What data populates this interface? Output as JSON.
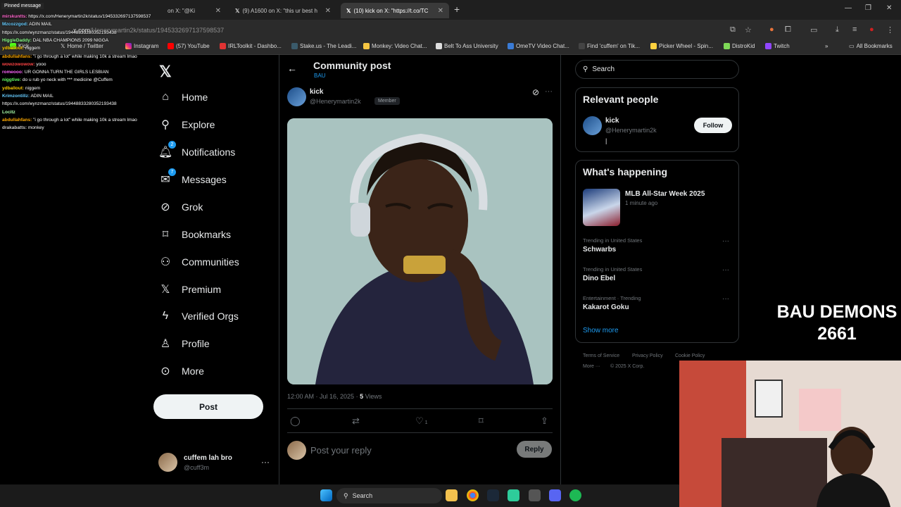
{
  "browser": {
    "tabs": [
      {
        "label": "on X: \"@Ki"
      },
      {
        "label": "(9) A1600 on X: \"this ur best h"
      },
      {
        "label": "(10) kick on X: \"https://t.co/TC"
      }
    ],
    "url_host": "x.com",
    "url_path": "/Henerymartin2k/status/1945332697137598537",
    "bookmarks": [
      {
        "label": "(57) YouTube",
        "color": "#ff0000"
      },
      {
        "label": "IRLToolkit - Dashbo...",
        "color": "#e03333"
      },
      {
        "label": "Stake.us - The Leadi...",
        "color": "#1a2c38"
      },
      {
        "label": "Monkey: Video Chat...",
        "color": "#f5c542"
      },
      {
        "label": "Belt To Ass University",
        "color": "#dddddd"
      },
      {
        "label": "OmeTV Video Chat...",
        "color": "#3a7bd5"
      },
      {
        "label": "Find 'cuffem' on Tik...",
        "color": "#111111"
      },
      {
        "label": "Picker Wheel - Spin...",
        "color": "#ffd23f"
      },
      {
        "label": "DistroKid",
        "color": "#7ed957"
      },
      {
        "label": "Twitch",
        "color": "#9146ff"
      }
    ],
    "all_bookmarks": "All Bookmarks",
    "instagram": "Instagram",
    "home_bm": "Home / Twitter",
    "kick_bm": "Kick"
  },
  "stream_chat": {
    "pinned": "Pinned message",
    "lines": [
      {
        "user": "mirskuntts:",
        "text": "https://x.com/Henerymartin2k/status/1945332697137598537",
        "color": "#ff66cc"
      },
      {
        "user": "Mzcozzgod:",
        "text": "ADIN MAIL",
        "color": "#66ccff"
      },
      {
        "user": "",
        "text": "https://x.com/wynzmanz/status/19448833280352193438",
        "color": "#ffffff"
      },
      {
        "user": "HiggleDaddy:",
        "text": "DAL NBA CHAMPIONS 2099 NIGGA",
        "color": "#88ff88"
      },
      {
        "user": "ydballout:",
        "text": "niggem",
        "color": "#ffcc00"
      },
      {
        "user": "abdullahfans:",
        "text": "\"i go through a lot\" while making 10k a stream lmao",
        "color": "#ffaa00"
      },
      {
        "user": "wowzowowow:",
        "text": "yooo",
        "color": "#ff4444"
      },
      {
        "user": "romeooo:",
        "text": "UR GONNA TURN THE GIRLS LESBIAN",
        "color": "#ff66ff"
      },
      {
        "user": "niggtive:",
        "text": "do u rub yo neck with *** medicine @Cuffem",
        "color": "#66ff66"
      },
      {
        "user": "ydballout:",
        "text": "niggem",
        "color": "#ffcc00"
      },
      {
        "user": "Krimzontillz:",
        "text": "ADIN MAIL",
        "color": "#66ccff"
      },
      {
        "user": "",
        "text": "https://x.com/wynzmanz/status/19448833280352193438",
        "color": "#ffffff"
      },
      {
        "user": "Locitz",
        "text": "",
        "color": "#aaffaa"
      },
      {
        "user": "abdullahfans:",
        "text": "\"i go through a lot\" while making 10k a stream lmao",
        "color": "#ffaa00"
      },
      {
        "user": "drakabatts:",
        "text": "monkey",
        "color": "#cccccc"
      }
    ]
  },
  "sidebar": {
    "items": [
      {
        "label": "Home",
        "icon": "home-icon"
      },
      {
        "label": "Explore",
        "icon": "search-icon"
      },
      {
        "label": "Notifications",
        "icon": "bell-icon",
        "badge": "2"
      },
      {
        "label": "Messages",
        "icon": "envelope-icon",
        "badge": "7"
      },
      {
        "label": "Grok",
        "icon": "grok-icon"
      },
      {
        "label": "Bookmarks",
        "icon": "bookmark-icon"
      },
      {
        "label": "Communities",
        "icon": "people-icon"
      },
      {
        "label": "Premium",
        "icon": "x-premium-icon"
      },
      {
        "label": "Verified Orgs",
        "icon": "lightning-icon"
      },
      {
        "label": "Profile",
        "icon": "person-icon"
      },
      {
        "label": "More",
        "icon": "more-circle-icon"
      }
    ],
    "post_label": "Post",
    "account": {
      "name": "cuffem lah bro",
      "handle": "@cuff3m"
    }
  },
  "main": {
    "title": "Community post",
    "subtitle": "BAU",
    "author": {
      "name": "kick",
      "handle": "@Henerymartin2k",
      "badge": "Member"
    },
    "timestamp": "12:00 AM · Jul 16, 2025 · ",
    "views_count": "5",
    "views_label": " Views",
    "likes": "1",
    "reply_placeholder": "Post your reply",
    "reply_button": "Reply"
  },
  "right": {
    "search_placeholder": "Search",
    "relevant_title": "Relevant people",
    "relevant": {
      "name": "kick",
      "handle": "@Henerymartin2k",
      "bio": "|",
      "follow_label": "Follow"
    },
    "happening_title": "What's happening",
    "featured": {
      "title": "MLB All-Star Week 2025",
      "time": "1 minute ago"
    },
    "trends": [
      {
        "context": "Trending in United States",
        "name": "Schwarbs"
      },
      {
        "context": "Trending in United States",
        "name": "Dino Ebel"
      },
      {
        "context": "Entertainment · Trending",
        "name": "Kakarot Goku"
      }
    ],
    "show_more": "Show more",
    "footer": {
      "terms": "Terms of Service",
      "privacy": "Privacy Policy",
      "cookie": "Cookie Policy",
      "more": "More ···",
      "copyright": "© 2025 X Corp."
    }
  },
  "overlay": {
    "line1": "BAU DEMONS",
    "line2": "2661"
  },
  "taskbar": {
    "search_label": "Search"
  }
}
